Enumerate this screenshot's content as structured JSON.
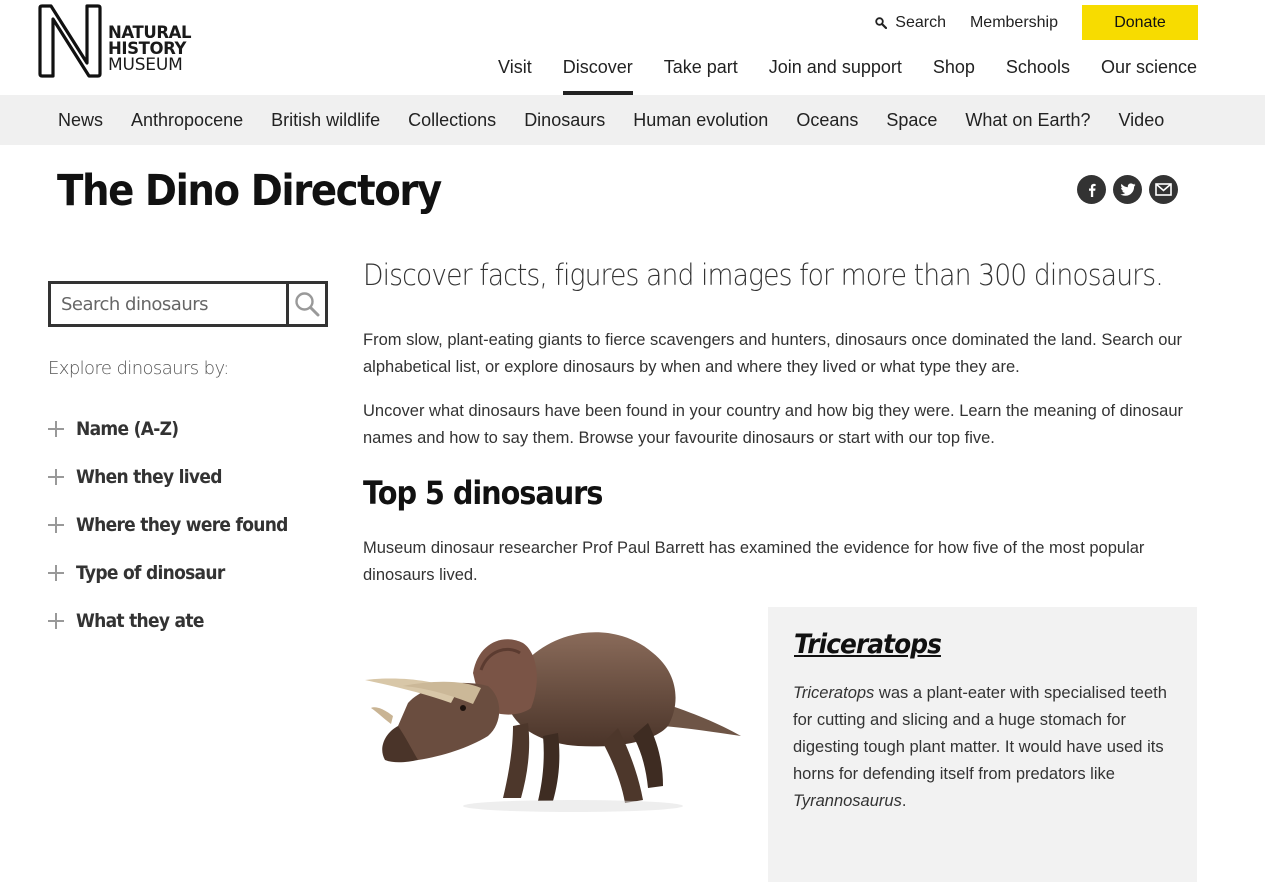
{
  "logo": {
    "line1": "NATURAL",
    "line2": "HISTORY",
    "line3": "MUSEUM"
  },
  "util": {
    "search": "Search",
    "membership": "Membership",
    "donate": "Donate"
  },
  "mainnav": [
    "Visit",
    "Discover",
    "Take part",
    "Join and support",
    "Shop",
    "Schools",
    "Our science"
  ],
  "mainnav_active": "Discover",
  "subnav": [
    "News",
    "Anthropocene",
    "British wildlife",
    "Collections",
    "Dinosaurs",
    "Human evolution",
    "Oceans",
    "Space",
    "What on Earth?",
    "Video"
  ],
  "page": {
    "title": "The Dino Directory"
  },
  "share": {
    "icons": [
      "facebook-icon",
      "twitter-icon",
      "email-icon"
    ]
  },
  "sidebar": {
    "search_placeholder": "Search dinosaurs",
    "explore_label": "Explore dinosaurs by:",
    "items": [
      "Name (A-Z)",
      "When they lived",
      "Where they were found",
      "Type of dinosaur",
      "What they ate"
    ]
  },
  "main": {
    "lead": "Discover facts, figures and images for more than 300 dinosaurs.",
    "p1": "From slow, plant-eating giants to fierce scavengers and hunters, dinosaurs once dominated the land. Search our alphabetical list, or explore dinosaurs by when and where they lived or what type they are.",
    "p2": "Uncover what dinosaurs have been found in your country and how big they were. Learn the meaning of dinosaur names and how to say them. Browse your favourite dinosaurs or start with our top five.",
    "top5_heading": "Top 5 dinosaurs",
    "p3": "Museum dinosaur researcher Prof Paul Barrett has examined the evidence for how five of the most popular dinosaurs lived."
  },
  "card": {
    "title": "Triceratops",
    "body_em1": "Triceratops",
    "body_mid": " was a plant-eater with specialised teeth for cutting and slicing and a huge stomach for digesting tough plant matter. It would have used its horns for defending itself from predators like ",
    "body_em2": "Tyrannosaurus",
    "body_end": "."
  },
  "colors": {
    "donate": "#f7dc00",
    "subnav_bg": "#f0f0f0",
    "card_bg": "#f2f2f2"
  }
}
